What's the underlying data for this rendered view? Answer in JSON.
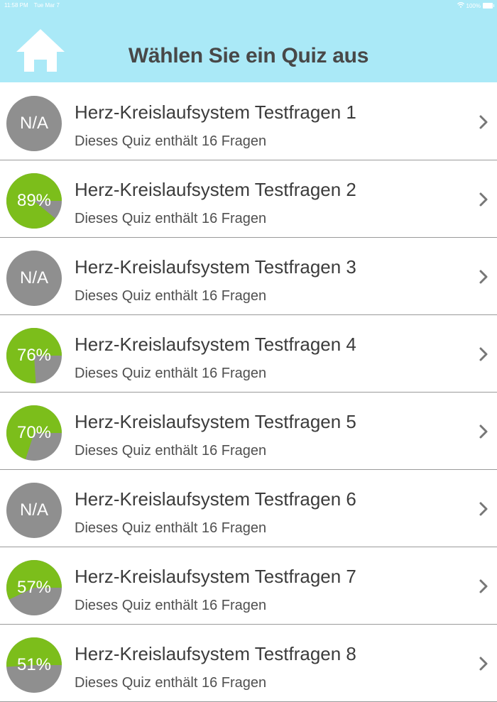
{
  "status_bar": {
    "time": "11:58 PM",
    "date": "Tue Mar 7",
    "battery": "100%"
  },
  "header": {
    "title": "Wählen Sie ein Quiz aus"
  },
  "colors": {
    "header_bg": "#aae9f7",
    "score_green": "#7cbe1b",
    "score_gray": "#8f8f8f"
  },
  "quizzes": [
    {
      "title": "Herz-Kreislaufsystem Testfragen 1",
      "subtitle": "Dieses Quiz enthält 16 Fragen",
      "score_label": "N/A",
      "score": null
    },
    {
      "title": "Herz-Kreislaufsystem Testfragen 2",
      "subtitle": "Dieses Quiz enthält 16 Fragen",
      "score_label": "89%",
      "score": 0.89
    },
    {
      "title": "Herz-Kreislaufsystem Testfragen 3",
      "subtitle": "Dieses Quiz enthält 16 Fragen",
      "score_label": "N/A",
      "score": null
    },
    {
      "title": "Herz-Kreislaufsystem Testfragen 4",
      "subtitle": "Dieses Quiz enthält 16 Fragen",
      "score_label": "76%",
      "score": 0.76
    },
    {
      "title": "Herz-Kreislaufsystem Testfragen 5",
      "subtitle": "Dieses Quiz enthält 16 Fragen",
      "score_label": "70%",
      "score": 0.7
    },
    {
      "title": "Herz-Kreislaufsystem Testfragen 6",
      "subtitle": "Dieses Quiz enthält 16 Fragen",
      "score_label": "N/A",
      "score": null
    },
    {
      "title": "Herz-Kreislaufsystem Testfragen 7",
      "subtitle": "Dieses Quiz enthält 16 Fragen",
      "score_label": "57%",
      "score": 0.57
    },
    {
      "title": "Herz-Kreislaufsystem Testfragen 8",
      "subtitle": "Dieses Quiz enthält 16 Fragen",
      "score_label": "51%",
      "score": 0.51
    }
  ]
}
